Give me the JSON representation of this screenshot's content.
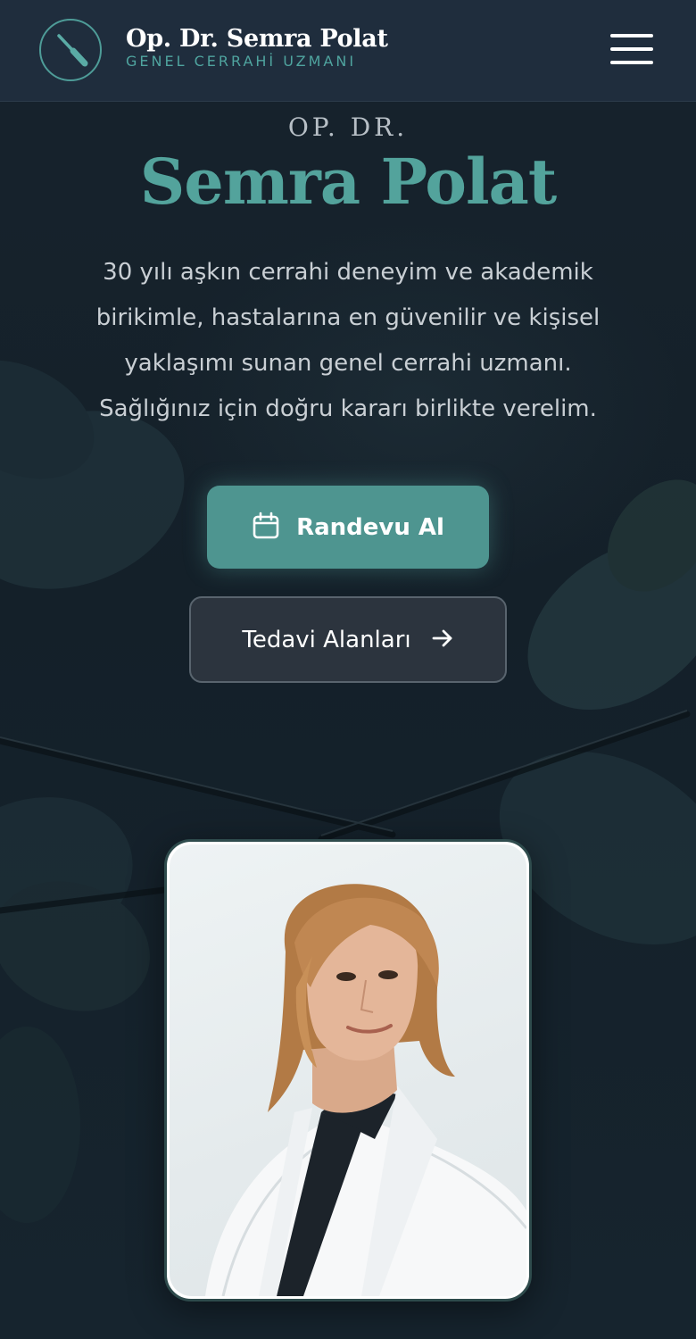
{
  "header": {
    "brand_name": "Op. Dr. Semra Polat",
    "brand_subtitle": "GENEL CERRAHİ UZMANI",
    "logo_icon": "scalpel-icon",
    "menu_icon": "hamburger-menu-icon"
  },
  "hero": {
    "kicker": "OP. DR.",
    "title": "Semra Polat",
    "description_lines": [
      "30 yılı aşkın cerrahi deneyim ve akademik",
      "birikimle, hastalarına en güvenilir ve kişisel",
      "yaklaşımı sunan genel cerrahi uzmanı.",
      "Sağlığınız için doğru kararı birlikte verelim."
    ],
    "primary_button": {
      "label": "Randevu Al",
      "icon": "calendar-icon"
    },
    "secondary_button": {
      "label": "Tedavi Alanları",
      "icon": "arrow-right-icon"
    }
  },
  "portrait": {
    "subject": "doctor-portrait"
  },
  "colors": {
    "accent": "#53a39c",
    "header_bg": "#1f2d3d",
    "page_bg": "#142029",
    "primary_button": "#4e9590"
  }
}
